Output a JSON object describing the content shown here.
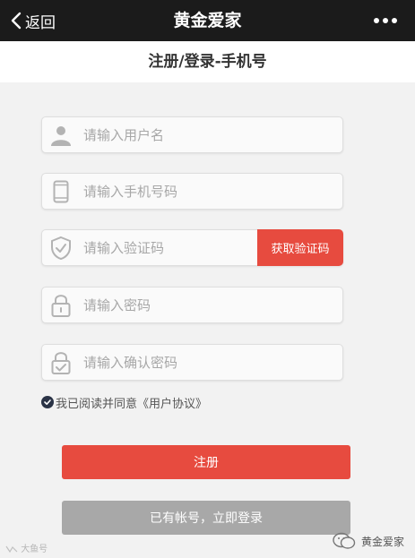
{
  "topbar": {
    "back_label": "返回",
    "title": "黄金爱家",
    "more_icon": "more-dots-icon"
  },
  "page_title": "注册/登录-手机号",
  "form": {
    "username": {
      "placeholder": "请输入用户名",
      "icon": "user-icon",
      "value": ""
    },
    "phone": {
      "placeholder": "请输入手机号码",
      "icon": "phone-icon",
      "value": ""
    },
    "code": {
      "placeholder": "请输入验证码",
      "icon": "shield-check-icon",
      "value": "",
      "button_label": "获取验证码"
    },
    "password": {
      "placeholder": "请输入密码",
      "icon": "lock-icon",
      "value": ""
    },
    "confirm": {
      "placeholder": "请输入确认密码",
      "icon": "lock-check-icon",
      "value": ""
    }
  },
  "agreement": {
    "checked": true,
    "text": "我已阅读并同意",
    "link": "《用户协议》"
  },
  "register_label": "注册",
  "login_label": "已有帐号，立即登录",
  "watermark": {
    "left": "大鱼号",
    "right": "黄金爱家"
  },
  "colors": {
    "topbar": "#1b1b1b",
    "accent": "#e74b3f",
    "secondary_button": "#a8a8a8",
    "background": "#f2f2f2"
  }
}
